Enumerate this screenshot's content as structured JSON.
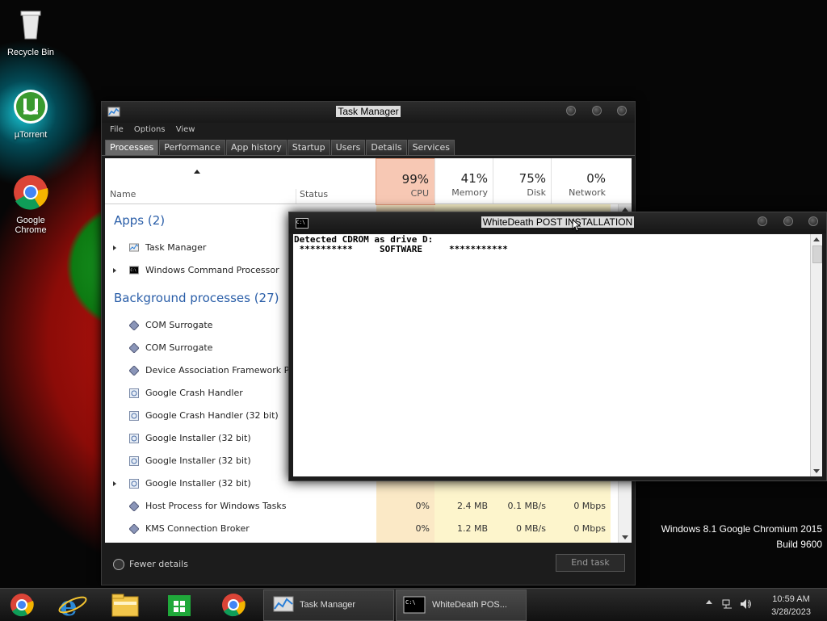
{
  "desktop": {
    "icons": [
      {
        "label": "Recycle Bin"
      },
      {
        "label": "µTorrent"
      },
      {
        "label": "Google Chrome"
      }
    ],
    "brand_line1": "Windows 8.1 Google Chromium 2015",
    "brand_line2": "Build 9600"
  },
  "task_manager": {
    "title": "Task Manager",
    "menu": [
      "File",
      "Options",
      "View"
    ],
    "tabs": [
      "Processes",
      "Performance",
      "App history",
      "Startup",
      "Users",
      "Details",
      "Services"
    ],
    "active_tab": "Processes",
    "columns": {
      "name": "Name",
      "status": "Status",
      "cpu": {
        "pct": "99%",
        "label": "CPU"
      },
      "memory": {
        "pct": "41%",
        "label": "Memory"
      },
      "disk": {
        "pct": "75%",
        "label": "Disk"
      },
      "network": {
        "pct": "0%",
        "label": "Network"
      }
    },
    "apps_header": "Apps (2)",
    "apps": [
      {
        "name": "Task Manager",
        "expandable": true
      },
      {
        "name": "Windows Command Processor",
        "expandable": true
      }
    ],
    "bg_header": "Background processes (27)",
    "background": [
      {
        "name": "COM Surrogate",
        "icon": "diamond-icon"
      },
      {
        "name": "COM Surrogate",
        "icon": "diamond-icon"
      },
      {
        "name": "Device Association Framework P...",
        "icon": "diamond-icon"
      },
      {
        "name": "Google Crash Handler",
        "icon": "installer-icon"
      },
      {
        "name": "Google Crash Handler (32 bit)",
        "icon": "installer-icon"
      },
      {
        "name": "Google Installer (32 bit)",
        "icon": "installer-icon"
      },
      {
        "name": "Google Installer (32 bit)",
        "icon": "installer-icon"
      },
      {
        "name": "Google Installer (32 bit)",
        "icon": "installer-icon",
        "expandable": true
      },
      {
        "name": "Host Process for Windows Tasks",
        "icon": "diamond-icon",
        "cpu": "0%",
        "memory": "2.4 MB",
        "disk": "0.1 MB/s",
        "network": "0 Mbps"
      },
      {
        "name": "KMS Connection Broker",
        "icon": "diamond-icon",
        "cpu": "0%",
        "memory": "1.2 MB",
        "disk": "0 MB/s",
        "network": "0 Mbps"
      }
    ],
    "fewer_details": "Fewer details",
    "end_task": "End task"
  },
  "cmd": {
    "title": "WhiteDeath POST INSTALLATION",
    "icon_text": "C:\\",
    "line1": "Detected CDROM as drive D:",
    "line2": " **********     SOFTWARE     ***********"
  },
  "taskbar": {
    "pinned": [
      "ie-chrome-icon",
      "internet-explorer-icon",
      "file-explorer-icon",
      "store-icon",
      "chrome-icon"
    ],
    "windows": [
      {
        "label": "Task Manager"
      },
      {
        "label": "WhiteDeath POS..."
      }
    ],
    "time": "10:59 AM",
    "date": "3/28/2023"
  }
}
